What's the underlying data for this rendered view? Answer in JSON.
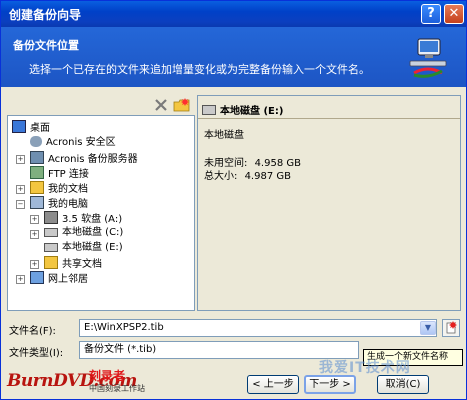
{
  "window": {
    "title": "创建备份向导",
    "help_label": "?",
    "close_label": "✕"
  },
  "header": {
    "title": "备份文件位置",
    "description": "选择一个已存在的文件来追加增量变化或为完整备份输入一个文件名。",
    "logo_icon": "network-computer-icon"
  },
  "tree": {
    "items": [
      {
        "label": "桌面",
        "icon": "desktop-icon"
      },
      {
        "label": "Acronis 安全区",
        "icon": "secure-zone-icon"
      },
      {
        "label": "Acronis 备份服务器",
        "icon": "backup-server-icon"
      },
      {
        "label": "FTP 连接",
        "icon": "ftp-icon"
      },
      {
        "label": "我的文档",
        "icon": "folder-icon"
      },
      {
        "label": "我的电脑",
        "icon": "computer-icon"
      },
      {
        "label": "3.5 软盘 (A:)",
        "icon": "floppy-icon"
      },
      {
        "label": "本地磁盘 (C:)",
        "icon": "drive-icon"
      },
      {
        "label": "本地磁盘 (E:)",
        "icon": "drive-icon"
      },
      {
        "label": "共享文档",
        "icon": "folder-icon"
      },
      {
        "label": "网上邻居",
        "icon": "network-icon"
      }
    ]
  },
  "info": {
    "heading": "本地磁盘  (E:)",
    "name": "本地磁盘",
    "used_label": "未用空间:",
    "used_value": "4.958 GB",
    "total_label": "总大小:",
    "total_value": "4.987 GB"
  },
  "form": {
    "filename_label": "文件名(F):",
    "filename_value": "E:\\WinXPSP2.tib",
    "filetype_label": "文件类型(I):",
    "filetype_value": "备份文件 (*.tib)"
  },
  "tooltip": "生成一个新文件名称",
  "buttons": {
    "back": "< 上一步",
    "next": "下一步 >",
    "cancel": "取消(C)"
  },
  "brand": {
    "site": "BurnDVD.com",
    "cn": "刻录者",
    "sub": "中国刻录工作站"
  },
  "watermark": "我爱IT技术网",
  "colors": {
    "titlebar": "#0a4fd6",
    "header": "#2262d2",
    "brand_red": "#b8140f"
  }
}
